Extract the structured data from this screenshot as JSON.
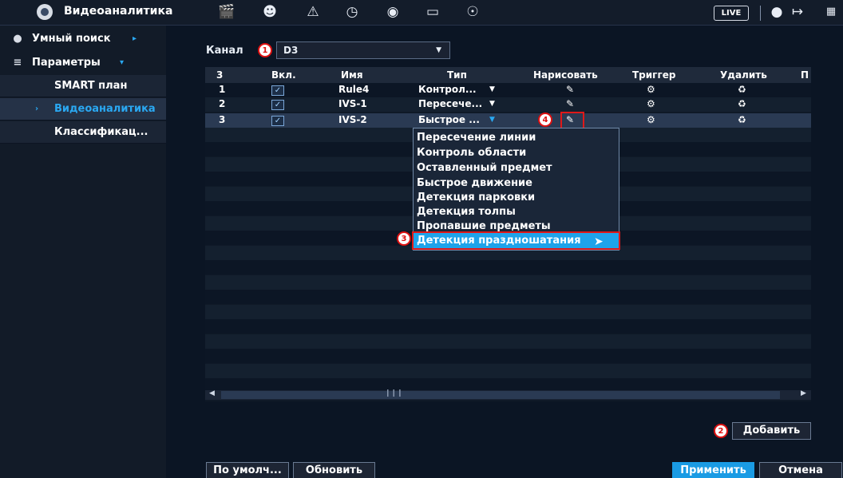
{
  "app": {
    "title": "Видеоаналитика",
    "live_label": "LIVE",
    "top_icons": [
      "film-icon",
      "face-icon",
      "alarm-light-icon",
      "speedometer-icon",
      "target-icon",
      "monitor-icon",
      "speaker-icon"
    ]
  },
  "sidebar": {
    "smart_search": "Умный поиск",
    "parameters": "Параметры",
    "items": [
      {
        "label": "SMART план"
      },
      {
        "label": "Видеоаналитика"
      },
      {
        "label": "Классификац..."
      }
    ]
  },
  "channel": {
    "label": "Канал",
    "value": "D3"
  },
  "table": {
    "columns": [
      "3",
      "Вкл.",
      "Имя",
      "Тип",
      "Нарисовать",
      "Триггер",
      "Удалить",
      "П"
    ],
    "rows": [
      {
        "num": "1",
        "enabled": true,
        "name": "Rule4",
        "type": "Контрол..."
      },
      {
        "num": "2",
        "enabled": true,
        "name": "IVS-1",
        "type": "Пересече..."
      },
      {
        "num": "3",
        "enabled": true,
        "name": "IVS-2",
        "type": "Быстрое ..."
      }
    ]
  },
  "type_menu": {
    "options": [
      "Пересечение линии",
      "Контроль области",
      "Оставленный предмет",
      "Быстрое движение",
      "Детекция парковки",
      "Детекция толпы",
      "Пропавшие предметы",
      "Детекция праздношатания"
    ],
    "highlighted_index": 7
  },
  "annotations": {
    "step1": "1",
    "step2": "2",
    "step3": "3",
    "step4": "4"
  },
  "buttons": {
    "add": "Добавить",
    "default": "По умолч...",
    "refresh": "Обновить",
    "apply": "Применить",
    "cancel": "Отмена"
  },
  "colors": {
    "accent": "#1a9be4",
    "highlight_box": "#e01818"
  }
}
